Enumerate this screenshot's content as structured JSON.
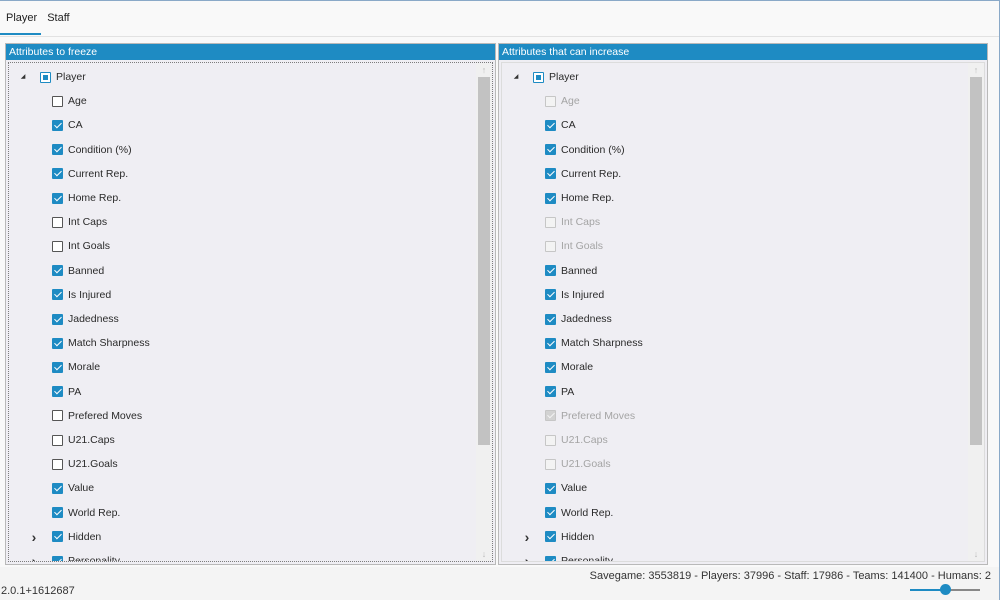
{
  "tabs": [
    {
      "label": "Player",
      "active": true
    },
    {
      "label": "Staff",
      "active": false
    }
  ],
  "panels": {
    "left": {
      "title": "Attributes to freeze",
      "items": [
        {
          "label": "Player",
          "state": "partial",
          "enabled": true,
          "expander": "expanded"
        },
        {
          "label": "Age",
          "state": "unchecked",
          "enabled": true
        },
        {
          "label": "CA",
          "state": "checked",
          "enabled": true
        },
        {
          "label": "Condition (%)",
          "state": "checked",
          "enabled": true
        },
        {
          "label": "Current Rep.",
          "state": "checked",
          "enabled": true
        },
        {
          "label": "Home Rep.",
          "state": "checked",
          "enabled": true
        },
        {
          "label": "Int Caps",
          "state": "unchecked",
          "enabled": true
        },
        {
          "label": "Int Goals",
          "state": "unchecked",
          "enabled": true
        },
        {
          "label": "Banned",
          "state": "checked",
          "enabled": true
        },
        {
          "label": "Is Injured",
          "state": "checked",
          "enabled": true
        },
        {
          "label": "Jadedness",
          "state": "checked",
          "enabled": true
        },
        {
          "label": "Match Sharpness",
          "state": "checked",
          "enabled": true
        },
        {
          "label": "Morale",
          "state": "checked",
          "enabled": true
        },
        {
          "label": "PA",
          "state": "checked",
          "enabled": true
        },
        {
          "label": "Prefered Moves",
          "state": "unchecked",
          "enabled": true
        },
        {
          "label": "U21.Caps",
          "state": "unchecked",
          "enabled": true
        },
        {
          "label": "U21.Goals",
          "state": "unchecked",
          "enabled": true
        },
        {
          "label": "Value",
          "state": "checked",
          "enabled": true
        },
        {
          "label": "World Rep.",
          "state": "checked",
          "enabled": true
        },
        {
          "label": "Hidden",
          "state": "checked",
          "enabled": true,
          "expander": "collapsed"
        },
        {
          "label": "Personality",
          "state": "checked",
          "enabled": true,
          "expander": "collapsed"
        }
      ]
    },
    "right": {
      "title": "Attributes that can increase",
      "items": [
        {
          "label": "Player",
          "state": "partial",
          "enabled": true,
          "expander": "expanded"
        },
        {
          "label": "Age",
          "state": "unchecked",
          "enabled": false
        },
        {
          "label": "CA",
          "state": "checked",
          "enabled": true
        },
        {
          "label": "Condition (%)",
          "state": "checked",
          "enabled": true
        },
        {
          "label": "Current Rep.",
          "state": "checked",
          "enabled": true
        },
        {
          "label": "Home Rep.",
          "state": "checked",
          "enabled": true
        },
        {
          "label": "Int Caps",
          "state": "unchecked",
          "enabled": false
        },
        {
          "label": "Int Goals",
          "state": "unchecked",
          "enabled": false
        },
        {
          "label": "Banned",
          "state": "checked",
          "enabled": true
        },
        {
          "label": "Is Injured",
          "state": "checked",
          "enabled": true
        },
        {
          "label": "Jadedness",
          "state": "checked",
          "enabled": true
        },
        {
          "label": "Match Sharpness",
          "state": "checked",
          "enabled": true
        },
        {
          "label": "Morale",
          "state": "checked",
          "enabled": true
        },
        {
          "label": "PA",
          "state": "checked",
          "enabled": true
        },
        {
          "label": "Prefered Moves",
          "state": "checked",
          "enabled": false
        },
        {
          "label": "U21.Caps",
          "state": "unchecked",
          "enabled": false
        },
        {
          "label": "U21.Goals",
          "state": "unchecked",
          "enabled": false
        },
        {
          "label": "Value",
          "state": "checked",
          "enabled": true
        },
        {
          "label": "World Rep.",
          "state": "checked",
          "enabled": true
        },
        {
          "label": "Hidden",
          "state": "checked",
          "enabled": true,
          "expander": "collapsed"
        },
        {
          "label": "Personality",
          "state": "checked",
          "enabled": true,
          "expander": "collapsed"
        }
      ]
    }
  },
  "status": {
    "summary": "Savegame: 3553819 - Players: 37996 - Staff: 17986 - Teams: 141400 - Humans: 2",
    "version": "2.0.1+1612687"
  },
  "zoom_slider_level": 0.5,
  "colors": {
    "accent": "#1e8bc3",
    "panel_background": "#efeef3",
    "disabled_text": "#a4a4a4"
  },
  "icons": {
    "expanded": "triangle-down-right-icon",
    "collapsed": "chevron-right-icon"
  }
}
